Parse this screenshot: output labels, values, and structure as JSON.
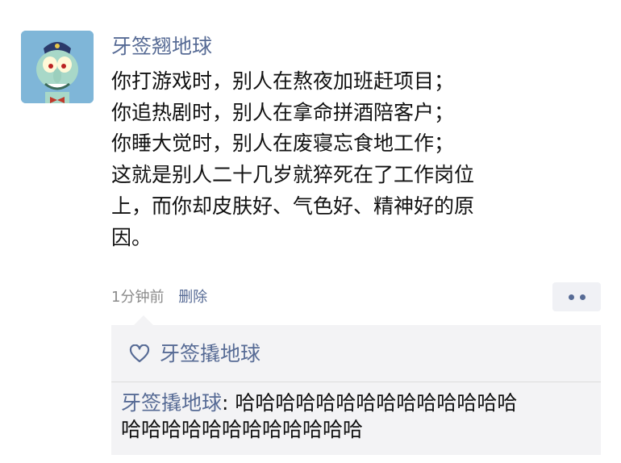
{
  "post": {
    "author": "牙签翘地球",
    "lines": [
      "你打游戏时，别人在熬夜加班赶项目；",
      "你追热剧时，别人在拿命拼酒陪客户；",
      "你睡大觉时，别人在废寝忘食地工作；",
      "这就是别人二十几岁就猝死在了工作岗位",
      "上，而你却皮肤好、气色好、精神好的原",
      "因。"
    ],
    "time": "1分钟前",
    "delete_label": "删除"
  },
  "likes": {
    "icon": "heart-icon",
    "names": "牙签撬地球"
  },
  "comment": {
    "author": "牙签撬地球",
    "separator": ": ",
    "text_line1": "哈哈哈哈哈哈哈哈哈哈哈哈哈哈",
    "text_line2": "哈哈哈哈哈哈哈哈哈哈哈哈"
  },
  "colors": {
    "link": "#576b95",
    "text": "#111111",
    "meta": "#8a8a8a",
    "panel": "#f3f3f5"
  }
}
